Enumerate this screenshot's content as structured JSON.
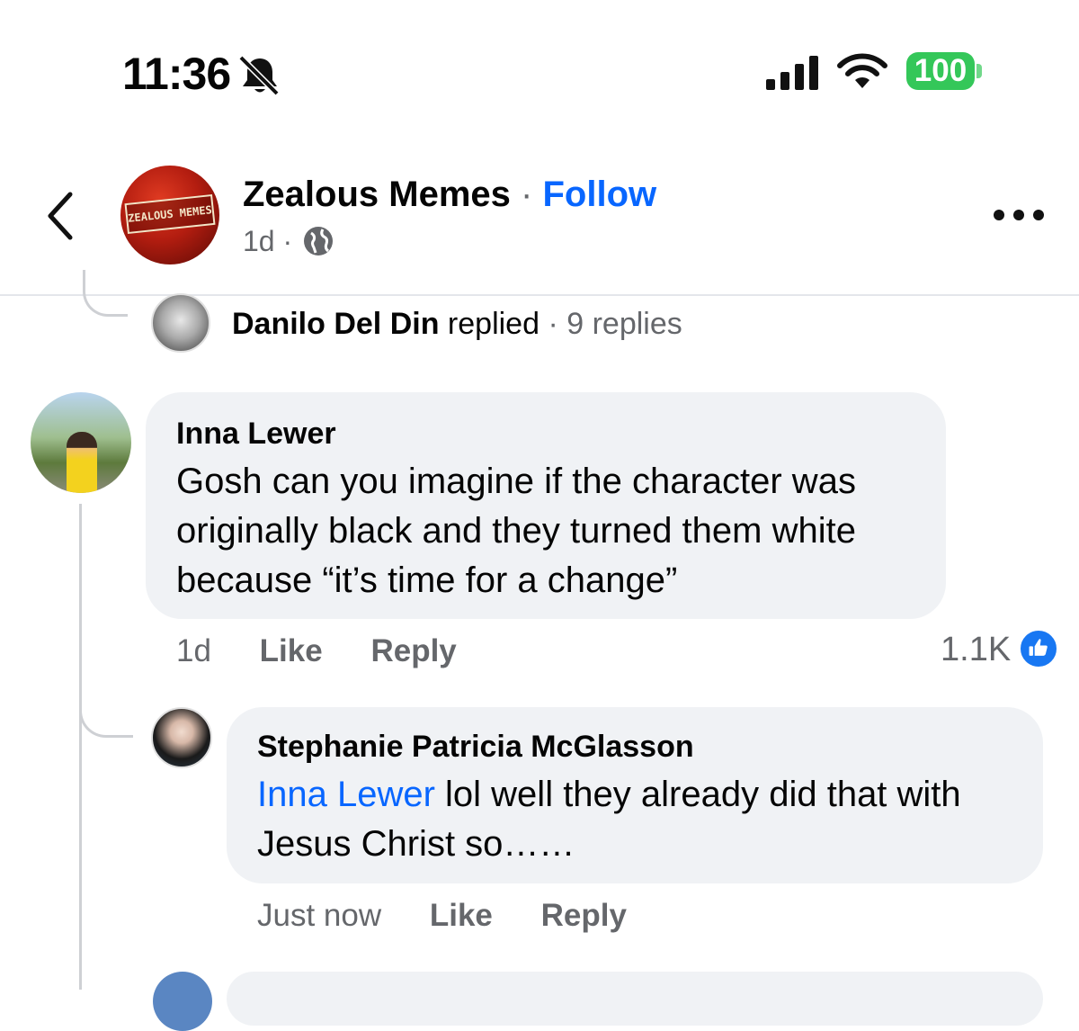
{
  "status_bar": {
    "time": "11:36",
    "battery": "100",
    "icons": [
      "bell-slash-icon",
      "signal-icon",
      "wifi-icon",
      "battery-icon"
    ]
  },
  "header": {
    "page_name": "Zealous Memes",
    "separator": "·",
    "follow_label": "Follow",
    "post_age": "1d",
    "meta_separator": "·",
    "avatar_text": "ZEALOUS MEMES",
    "icons": [
      "back-chevron-icon",
      "globe-icon",
      "more-icon"
    ]
  },
  "previous_reply": {
    "name": "Danilo Del Din",
    "action": "replied",
    "separator": "·",
    "count": "9 replies"
  },
  "comment": {
    "author": "Inna Lewer",
    "text": "Gosh can you imagine if the character was originally black and they turned them white because “it’s time for a change”",
    "age": "1d",
    "like_label": "Like",
    "reply_label": "Reply",
    "reaction_count": "1.1K",
    "reaction_icon": "thumbs-up-icon",
    "accent_color": "#1877f2"
  },
  "reply": {
    "author": "Stephanie Patricia McGlasson",
    "mention": "Inna Lewer",
    "text": " lol well they already did that with Jesus Christ so……",
    "age": "Just now",
    "like_label": "Like",
    "reply_label": "Reply",
    "mention_color": "#0866ff"
  }
}
